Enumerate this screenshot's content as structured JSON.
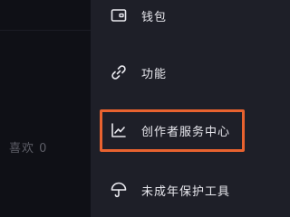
{
  "background": {
    "likes_label": "喜欢 0"
  },
  "menu": {
    "items": [
      {
        "label": "钱包",
        "icon": "wallet-icon"
      },
      {
        "label": "功能",
        "icon": "link-icon"
      },
      {
        "label": "创作者服务中心",
        "icon": "chart-trend-icon"
      },
      {
        "label": "未成年保护工具",
        "icon": "umbrella-icon"
      }
    ]
  },
  "colors": {
    "panel_bg": "#1e1f28",
    "page_bg": "#0f1016",
    "highlight": "#e8622f",
    "text": "#e8e8ee"
  }
}
